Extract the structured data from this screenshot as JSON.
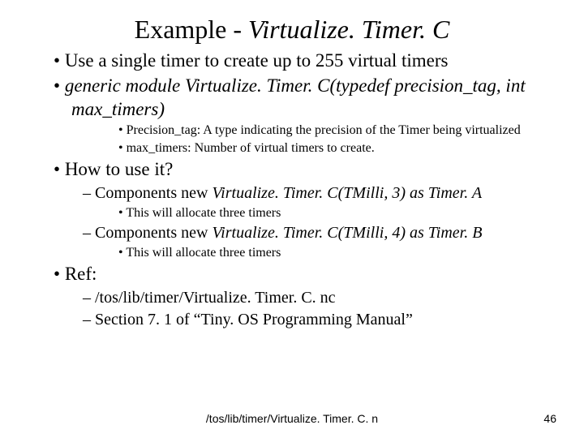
{
  "title_prefix": "Example - ",
  "title_italic": "Virtualize. Timer. C",
  "b1": "Use a single timer to create up to 255 virtual timers",
  "b2": "generic module Virtualize. Timer. C(typedef precision_tag, int max_timers)",
  "b2a": "Precision_tag: A type indicating the precision of the Timer being virtualized",
  "b2b": "max_timers: Number of virtual timers to create.",
  "b3": "How to use it?",
  "b3a_pre": "Components new ",
  "b3a_it": "Virtualize. Timer. C(TMilli, 3) as Timer. A",
  "b3a1": "This will allocate three timers",
  "b3b_pre": "Components new ",
  "b3b_it": "Virtualize. Timer. C(TMilli, 4) as Timer. B",
  "b3b1": "This will allocate three timers",
  "b4": "Ref:",
  "b4a": "/tos/lib/timer/Virtualize. Timer. C. nc",
  "b4b": "Section 7. 1 of “Tiny. OS Programming Manual”",
  "footer_center": "/tos/lib/timer/Virtualize. Timer. C. n",
  "footer_right": "46"
}
